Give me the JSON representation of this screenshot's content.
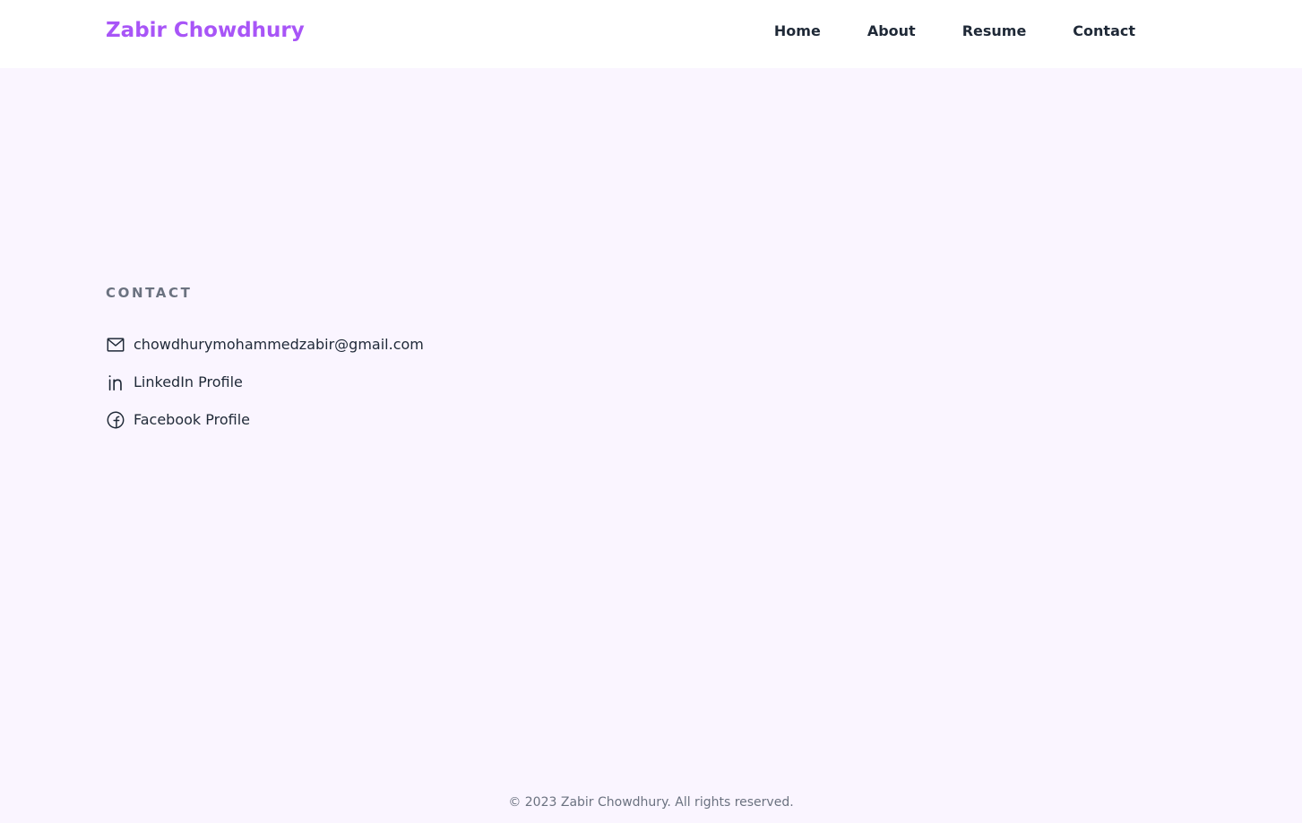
{
  "header": {
    "brand": "Zabir Chowdhury",
    "nav": [
      {
        "label": "Home"
      },
      {
        "label": "About"
      },
      {
        "label": "Resume"
      },
      {
        "label": "Contact"
      }
    ]
  },
  "contact": {
    "heading": "CONTACT",
    "items": [
      {
        "icon": "mail-icon",
        "label": "chowdhurymohammedzabir@gmail.com"
      },
      {
        "icon": "linkedin-icon",
        "label": "LinkedIn Profile"
      },
      {
        "icon": "facebook-icon",
        "label": "Facebook Profile"
      }
    ]
  },
  "footer": {
    "text": "© 2023 Zabir Chowdhury. All rights reserved."
  },
  "colors": {
    "accent": "#a855f7",
    "background": "#faf5ff",
    "text": "#1f2937",
    "muted": "#6b7280"
  }
}
